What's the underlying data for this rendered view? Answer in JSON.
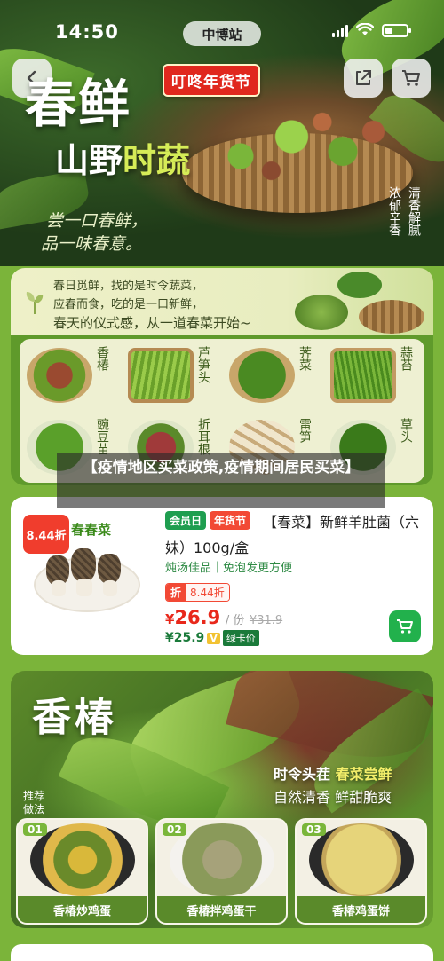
{
  "status_bar": {
    "time": "14:50",
    "site": "中博站"
  },
  "hero": {
    "promo_tag": "叮咚年货节",
    "title": "春鲜",
    "subtitle_a": "山野",
    "subtitle_b": "时蔬",
    "slogan_line1": "尝一口春鲜，",
    "slogan_line2": "品一味春意。",
    "tags": [
      "浓郁辛香",
      "清香解腻"
    ]
  },
  "panel": {
    "line1": "春日觅鲜，找的是时令蔬菜，",
    "line2": "应春而食，吃的是一口新鲜，",
    "line3": "春天的仪式感，从一道春菜开始~",
    "vegetables": [
      {
        "name": "香椿"
      },
      {
        "name": "芦笋头"
      },
      {
        "name": "荠菜"
      },
      {
        "name": "蒜苔"
      },
      {
        "name": "豌豆苗"
      },
      {
        "name": "折耳根"
      },
      {
        "name": "雷笋"
      },
      {
        "name": "草头"
      }
    ]
  },
  "overlay": {
    "text": "【疫情地区买菜政策,疫情期间居民买菜】"
  },
  "product": {
    "discount_badge": "8.44折",
    "image_brand": "春春菜",
    "badge_member": "会员日",
    "badge_festival": "年货节",
    "title": "【春菜】新鲜羊肚菌（六妹）100g/盒",
    "subtitle": "炖汤佳品｜免泡发更方便",
    "disc_label": "折",
    "disc_value": "8.44折",
    "currency": "¥",
    "price": "26.9",
    "unit": "/ 份",
    "old_price": "¥31.9",
    "member_price": "¥25.9",
    "member_v": "V",
    "member_card": "绿卡价"
  },
  "recipe": {
    "title": "香椿",
    "slogan1_a": "时令头茬 ",
    "slogan1_b": "春菜尝鲜",
    "slogan2": "自然清香 鲜甜脆爽",
    "hint": "推荐做法",
    "dishes": [
      {
        "num": "01",
        "name": "香椿炒鸡蛋"
      },
      {
        "num": "02",
        "name": "香椿拌鸡蛋干"
      },
      {
        "num": "03",
        "name": "香椿鸡蛋饼"
      }
    ]
  },
  "colors": {
    "accent_green": "#22b14c",
    "price_red": "#e8281b",
    "background": "#7bb43a"
  }
}
